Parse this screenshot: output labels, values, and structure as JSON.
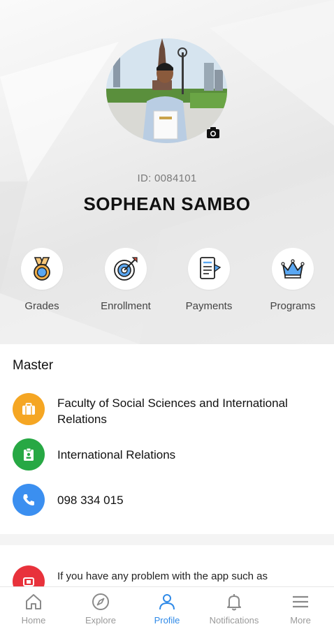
{
  "profile": {
    "id_text": "ID: 0084101",
    "name": "SOPHEAN SAMBO"
  },
  "quick_actions": [
    {
      "label": "Grades",
      "icon": "medal-icon"
    },
    {
      "label": "Enrollment",
      "icon": "target-icon"
    },
    {
      "label": "Payments",
      "icon": "invoice-icon"
    },
    {
      "label": "Programs",
      "icon": "crown-icon"
    }
  ],
  "details": {
    "section_title": "Master",
    "faculty": "Faculty of Social Sciences and International Relations",
    "major": "International Relations",
    "phone": "098 334 015"
  },
  "notice": {
    "text": "If you have any problem with the app such as"
  },
  "tabs": [
    {
      "label": "Home",
      "icon": "home-icon"
    },
    {
      "label": "Explore",
      "icon": "compass-icon"
    },
    {
      "label": "Profile",
      "icon": "person-icon"
    },
    {
      "label": "Notifications",
      "icon": "bell-icon"
    },
    {
      "label": "More",
      "icon": "menu-icon"
    }
  ],
  "colors": {
    "accent": "#2f8ae8",
    "faculty_icon": "#f5a623",
    "major_icon": "#27a844",
    "phone_icon": "#3b8ff0",
    "notice_icon": "#e8323b"
  }
}
